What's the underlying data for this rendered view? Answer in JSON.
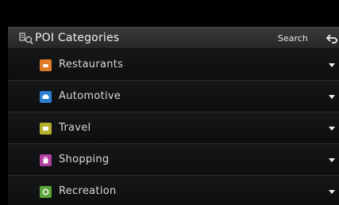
{
  "header": {
    "title": "POI Categories",
    "search_label": "Search",
    "icon": "poi-categories-icon",
    "back_icon": "back-arrow-icon"
  },
  "categories": [
    {
      "label": "Restaurants",
      "icon": "restaurant-icon",
      "color": "#e07b2a"
    },
    {
      "label": "Automotive",
      "icon": "car-icon",
      "color": "#2a7fd0"
    },
    {
      "label": "Travel",
      "icon": "travel-icon",
      "color": "#b6b02a"
    },
    {
      "label": "Shopping",
      "icon": "shopping-bag-icon",
      "color": "#b23fa0"
    },
    {
      "label": "Recreation",
      "icon": "recreation-icon",
      "color": "#5aa43a"
    }
  ]
}
